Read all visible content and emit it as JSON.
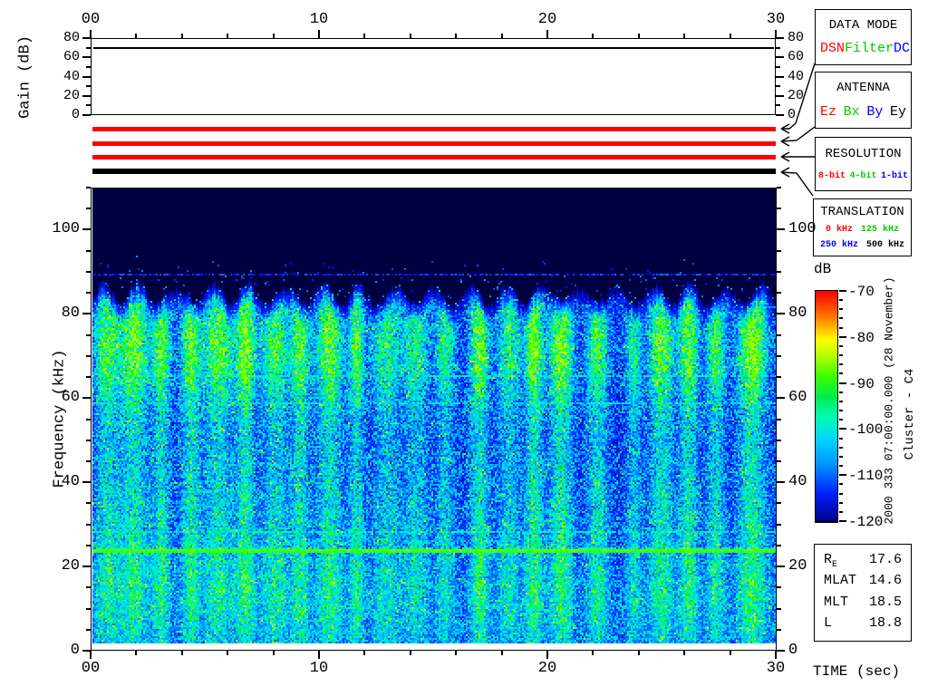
{
  "gain_plot": {
    "ylabel": "Gain (dB)",
    "ymin": 0,
    "ymax": 80,
    "ytick_values": [
      0,
      20,
      40,
      60,
      80
    ],
    "ytick_labels": [
      "0",
      "20",
      "40",
      "60",
      "80"
    ],
    "yminor_values": [
      10,
      30,
      50,
      70
    ],
    "gain_line_db": 70
  },
  "time_axis": {
    "label": "TIME (sec)",
    "tmin": 0,
    "tmax": 30,
    "tick_values": [
      0,
      10,
      20,
      30
    ],
    "tick_labels": [
      "00",
      "10",
      "20",
      "30"
    ],
    "minor_step": 2
  },
  "mode_bars": [
    {
      "color": "#ff0000"
    },
    {
      "color": "#ff0000"
    },
    {
      "color": "#ff0000"
    },
    {
      "color": "#000000"
    }
  ],
  "panels": [
    {
      "title": "DATA MODE",
      "items": [
        {
          "text": "DSN",
          "color": "#ff0000"
        },
        {
          "text": "Filter",
          "color": "#00cc00"
        },
        {
          "text": "DC",
          "color": "#0000ff"
        }
      ]
    },
    {
      "title": "ANTENNA",
      "items": [
        {
          "text": "Ez",
          "color": "#ff0000"
        },
        {
          "text": "Bx",
          "color": "#00cc00"
        },
        {
          "text": "By",
          "color": "#0000ff"
        },
        {
          "text": "Ey",
          "color": "#000000"
        }
      ]
    },
    {
      "title": "RESOLUTION",
      "small": true,
      "items": [
        {
          "text": "8-bit",
          "color": "#ff0000"
        },
        {
          "text": "4-bit",
          "color": "#00cc00"
        },
        {
          "text": "1-bit",
          "color": "#0000ff"
        }
      ]
    },
    {
      "title": "TRANSLATION",
      "rows": [
        [
          {
            "text": "0 kHz",
            "color": "#ff0000"
          },
          {
            "text": "125 kHz",
            "color": "#00cc00"
          }
        ],
        [
          {
            "text": "250 kHz",
            "color": "#0000ff"
          },
          {
            "text": "500 kHz",
            "color": "#000000"
          }
        ]
      ]
    }
  ],
  "spectrogram": {
    "ylabel": "Frequency (kHz)",
    "fmin": 0,
    "fmax": 110,
    "ytick_values": [
      0,
      20,
      40,
      60,
      80,
      100
    ],
    "ytick_labels": [
      "0",
      "20",
      "40",
      "60",
      "80",
      "100"
    ],
    "yminor_step": 5,
    "background_color": "#000041"
  },
  "colorbar": {
    "title": "dB",
    "vmin": -120,
    "vmax": -70,
    "tick_values": [
      -70,
      -80,
      -90,
      -100,
      -110,
      -120
    ],
    "tick_labels": [
      "-70",
      "-80",
      "-90",
      "-100",
      "-110",
      "-120"
    ],
    "minor_step": 2
  },
  "side_annotations": {
    "datetime": "2000 333 07:00:00.000 (28 November)",
    "spacecraft": "Cluster - C4"
  },
  "info_panel": {
    "rows": [
      {
        "label": "R",
        "sub": "E",
        "value": "17.6"
      },
      {
        "label": "MLAT",
        "sub": "",
        "value": "14.6"
      },
      {
        "label": "MLT",
        "sub": "",
        "value": "18.5"
      },
      {
        "label": "L",
        "sub": "",
        "value": "18.8"
      }
    ]
  },
  "chart_data": [
    {
      "type": "line",
      "title": "Receiver gain vs time",
      "ylabel": "Gain (dB)",
      "ylim": [
        0,
        80
      ],
      "xlim": [
        0,
        30
      ],
      "x": [
        0,
        30
      ],
      "y": [
        70,
        70
      ]
    },
    {
      "type": "heatmap",
      "title": "Cluster C4 WBD wideband spectrogram",
      "xlabel": "TIME (sec)",
      "ylabel": "Frequency (kHz)",
      "xlim": [
        0,
        30
      ],
      "ylim": [
        0,
        110
      ],
      "color_scale_db": [
        -120,
        -70
      ],
      "legend_position": "right-colorbar",
      "noise_cutoff_khz": 85,
      "spectral_lines": [
        {
          "khz": 24,
          "intensity_db": -89,
          "style": "solid"
        },
        {
          "khz": 28,
          "intensity_db": -99,
          "style": "speckled"
        },
        {
          "khz": 59,
          "intensity_db": -100,
          "style": "speckled"
        },
        {
          "khz": 65.5,
          "intensity_db": -100,
          "style": "speckled"
        },
        {
          "khz": 89.5,
          "intensity_db": -114,
          "style": "speckled"
        }
      ],
      "plumes": {
        "peak_khz": 73,
        "times_sec": [
          0.6,
          1.8,
          3.0,
          4.3,
          5.5,
          6.7,
          8.0,
          9.1,
          10.4,
          11.6,
          12.9,
          14.2,
          15.5,
          17.0,
          18.3,
          19.4,
          20.6,
          22.2,
          23.8,
          25.0,
          26.2,
          27.4,
          29.0
        ]
      }
    }
  ]
}
